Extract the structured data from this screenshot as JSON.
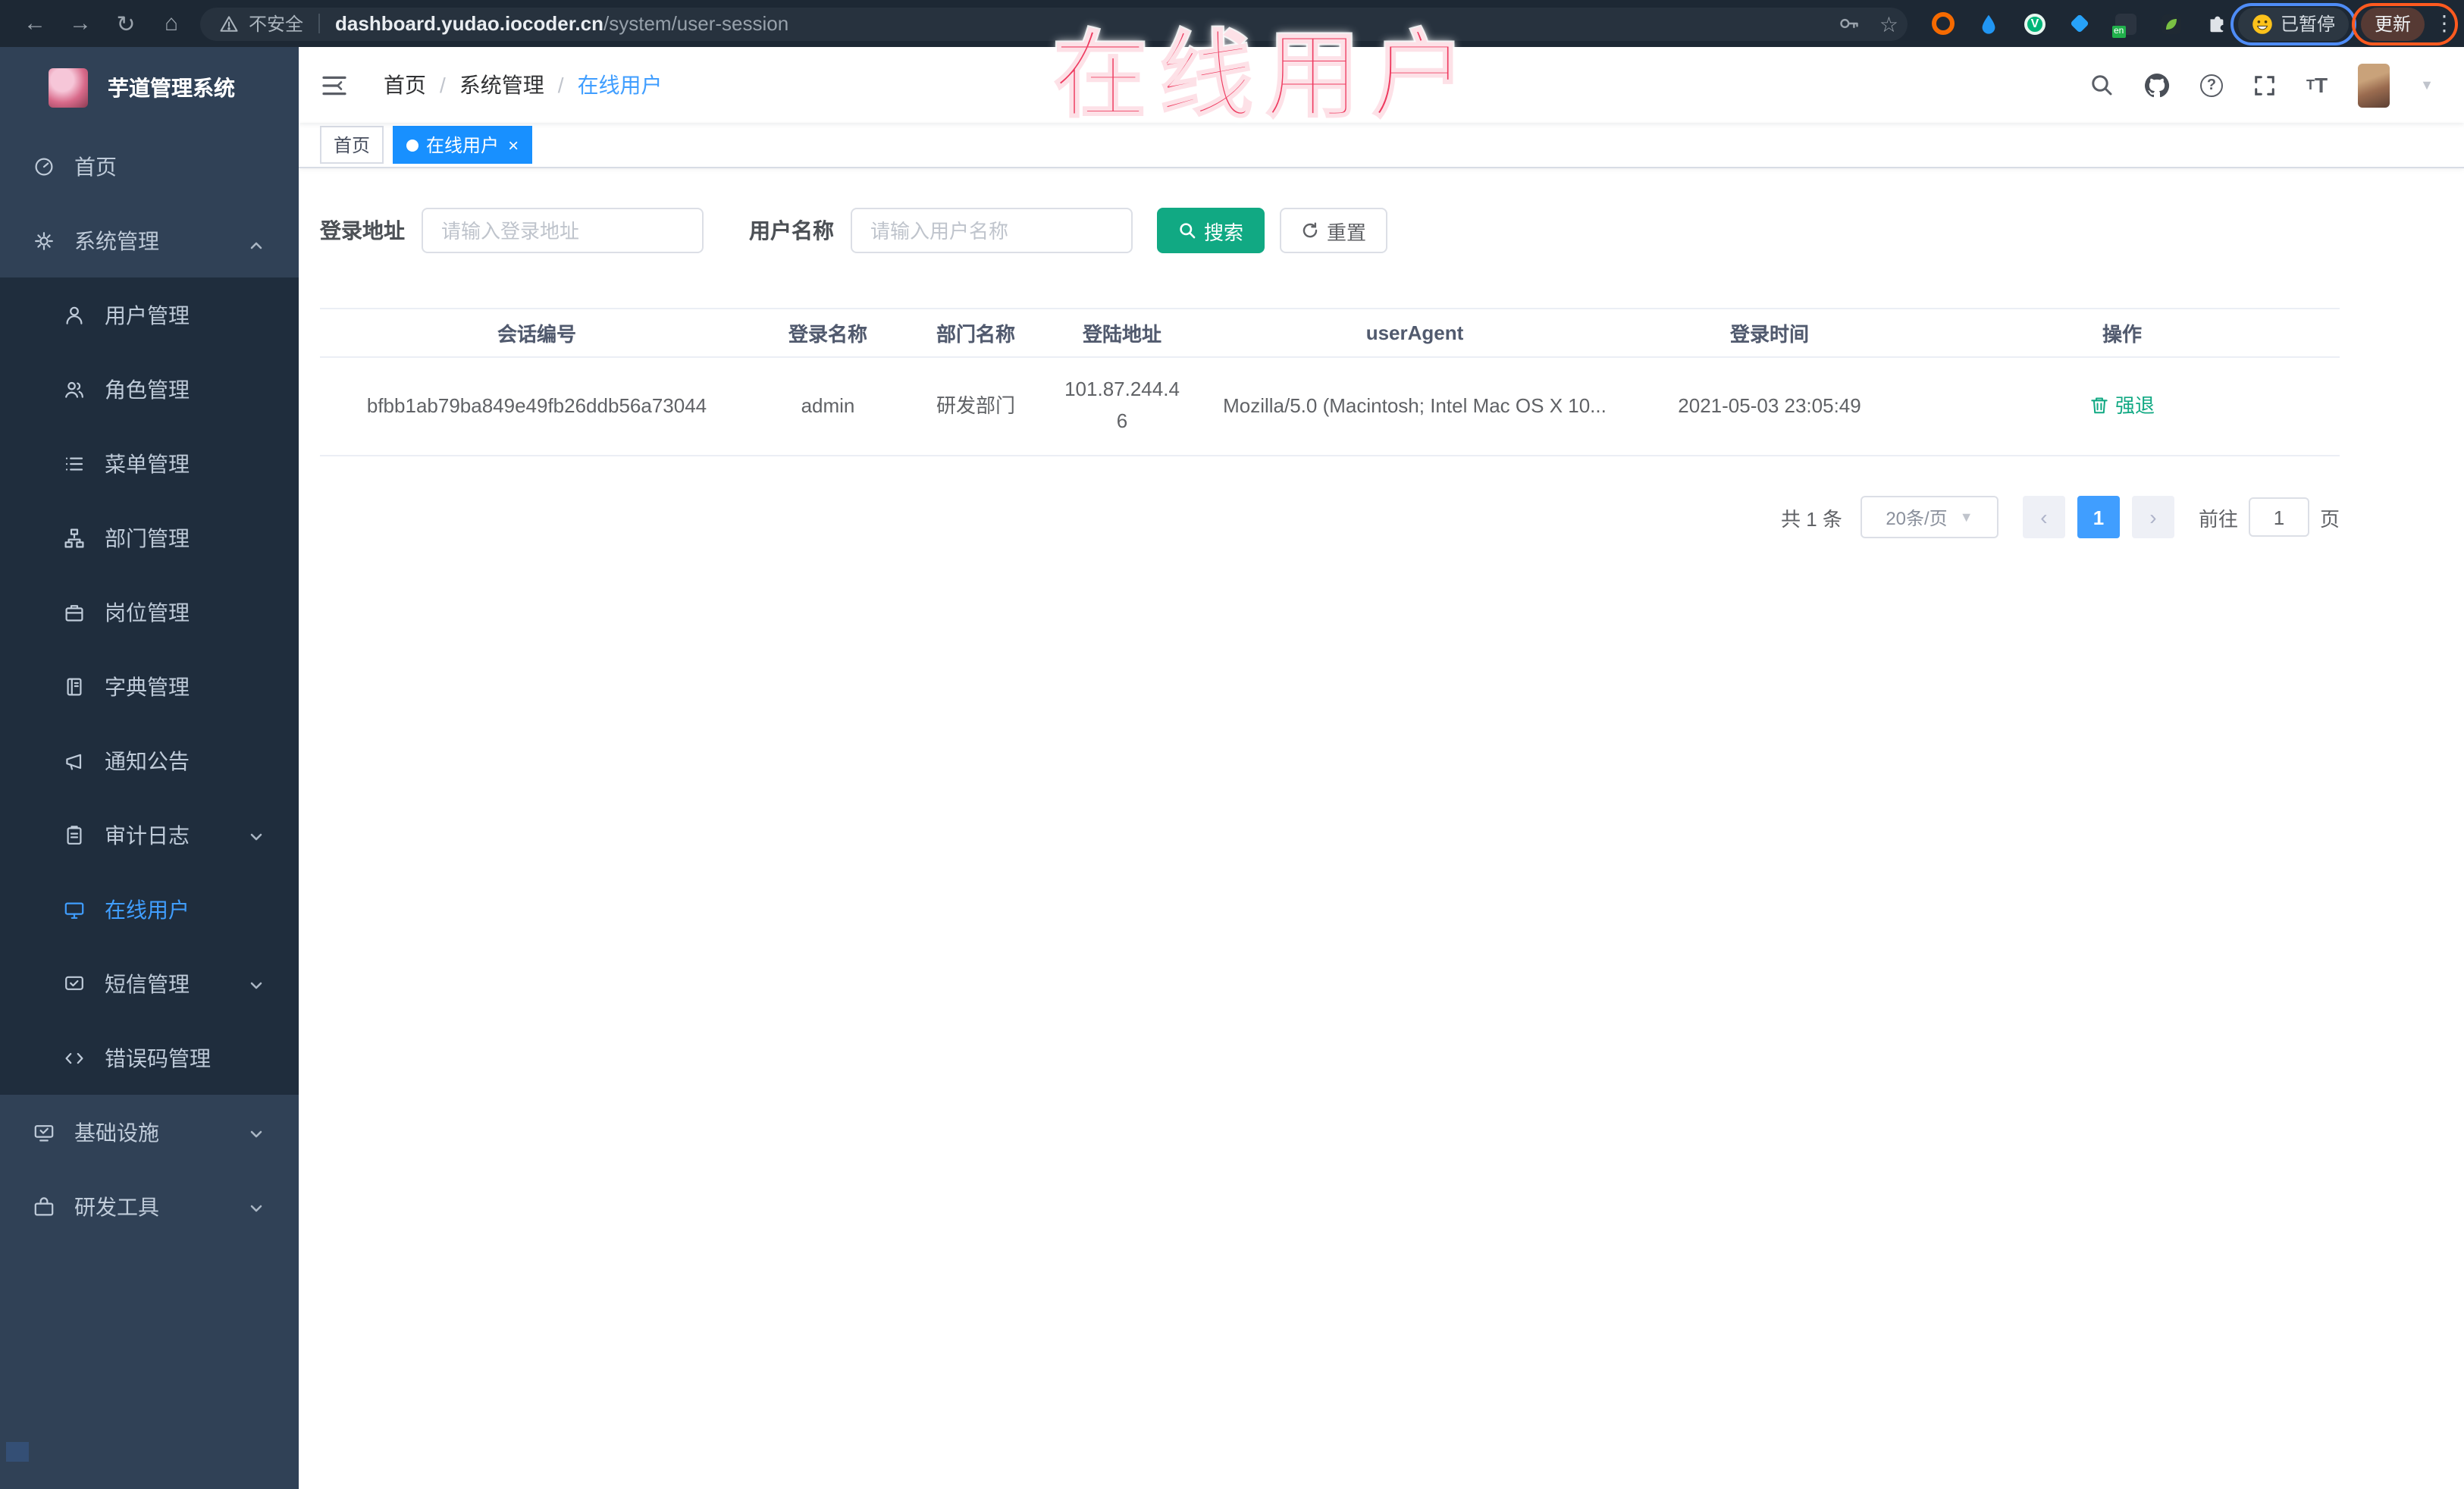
{
  "colors": {
    "accent_blue": "#409eff",
    "tab_active_blue": "#1890ff",
    "teal_primary": "#11a983",
    "sidebar_bg": "#304156",
    "submenu_bg": "#1f2d3d",
    "annotation_red": "#ee3a5f",
    "browser_bar_bg": "#1d2834"
  },
  "browser": {
    "security_label": "不安全",
    "url_host": "dashboard.yudao.iocoder.cn",
    "url_path": "/system/user-session",
    "profile_status": "已暂停",
    "update_label": "更新"
  },
  "annotation": {
    "title": "在线用户"
  },
  "sidebar": {
    "logo_title": "芋道管理系统",
    "items": [
      {
        "name": "sidebar-item-home",
        "label": "首页",
        "icon": "dashboard-icon",
        "level": 1
      },
      {
        "name": "sidebar-item-system-mgmt",
        "label": "系统管理",
        "icon": "gear-icon",
        "level": 1,
        "caret": "up"
      },
      {
        "name": "sidebar-item-user-mgmt",
        "label": "用户管理",
        "icon": "user-icon",
        "level": 2
      },
      {
        "name": "sidebar-item-role-mgmt",
        "label": "角色管理",
        "icon": "users-icon",
        "level": 2
      },
      {
        "name": "sidebar-item-menu-mgmt",
        "label": "菜单管理",
        "icon": "list-icon",
        "level": 2
      },
      {
        "name": "sidebar-item-dept-mgmt",
        "label": "部门管理",
        "icon": "tree-icon",
        "level": 2
      },
      {
        "name": "sidebar-item-post-mgmt",
        "label": "岗位管理",
        "icon": "briefcase-icon",
        "level": 2
      },
      {
        "name": "sidebar-item-dict-mgmt",
        "label": "字典管理",
        "icon": "book-icon",
        "level": 2
      },
      {
        "name": "sidebar-item-notice",
        "label": "通知公告",
        "icon": "megaphone-icon",
        "level": 2
      },
      {
        "name": "sidebar-item-audit-log",
        "label": "审计日志",
        "icon": "clipboard-icon",
        "level": 2,
        "caret": "down"
      },
      {
        "name": "sidebar-item-online-user",
        "label": "在线用户",
        "icon": "online-icon",
        "level": 2,
        "active": true
      },
      {
        "name": "sidebar-item-sms-mgmt",
        "label": "短信管理",
        "icon": "message-icon",
        "level": 2,
        "caret": "down"
      },
      {
        "name": "sidebar-item-error-code",
        "label": "错误码管理",
        "icon": "code-icon",
        "level": 2
      },
      {
        "name": "sidebar-item-infrastructure",
        "label": "基础设施",
        "icon": "server-icon",
        "level": 1,
        "caret": "down"
      },
      {
        "name": "sidebar-item-dev-tools",
        "label": "研发工具",
        "icon": "toolbox-icon",
        "level": 1,
        "caret": "down"
      }
    ]
  },
  "header": {
    "breadcrumb": [
      {
        "label": "首页"
      },
      {
        "label": "系统管理"
      },
      {
        "label": "在线用户",
        "active": true
      }
    ]
  },
  "tabs": [
    {
      "label": "首页"
    },
    {
      "label": "在线用户",
      "active": true,
      "closable": true
    }
  ],
  "filters": {
    "login_address_label": "登录地址",
    "login_address_placeholder": "请输入登录地址",
    "username_label": "用户名称",
    "username_placeholder": "请输入用户名称",
    "search_label": "搜索",
    "reset_label": "重置"
  },
  "table": {
    "columns": [
      "会话编号",
      "登录名称",
      "部门名称",
      "登陆地址",
      "userAgent",
      "登录时间",
      "操作"
    ],
    "rows": [
      {
        "session_id": "bfbb1ab79ba849e49fb26ddb56a73044",
        "username": "admin",
        "dept": "研发部门",
        "ip": "101.87.244.46",
        "user_agent": "Mozilla/5.0 (Macintosh; Intel Mac OS X 10...",
        "login_time": "2021-05-03 23:05:49",
        "action": "强退"
      }
    ]
  },
  "pagination": {
    "total": "共 1 条",
    "page_size": "20条/页",
    "page": "1",
    "prev": "‹",
    "next": "›",
    "goto_label": "前往",
    "goto_value": "1",
    "unit_label": "页"
  }
}
